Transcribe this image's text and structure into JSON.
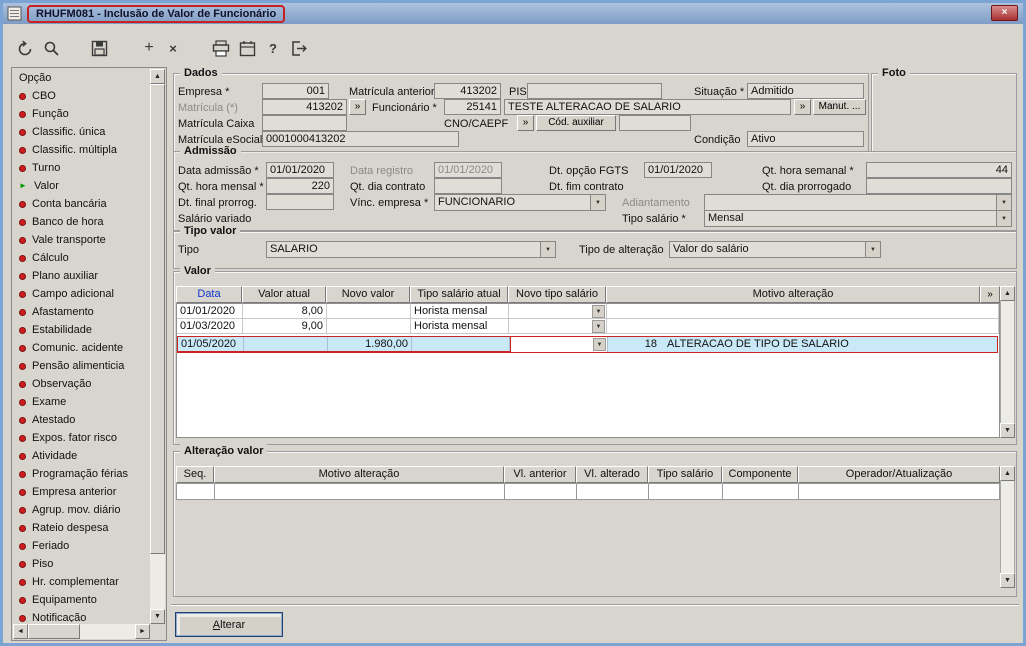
{
  "window": {
    "title": "RHUFM081 - Inclusão de Valor de Funcionário"
  },
  "icons": {
    "add": "+",
    "delete": "×",
    "help": "?",
    "close": "×",
    "lookup": "»",
    "dropdown": "▼",
    "grid_more": "»",
    "selected_arrow": "►",
    "scroll_up": "▲",
    "scroll_down": "▼",
    "scroll_left": "◄",
    "scroll_right": "►",
    "toolbar": [
      "undo",
      "search",
      "save",
      "add",
      "delete",
      "print",
      "calendar",
      "help",
      "exit"
    ]
  },
  "colors": {
    "annotation_red": "#cc2222",
    "selected_row_blue": "#c9e9f8",
    "titlebar_blue": "#7e9cc4",
    "bullet_red": "#cf1d1d",
    "selected_item_green": "#009a00",
    "header_link_blue": "#1133cc"
  },
  "sidebar": {
    "header": "Opção",
    "items": [
      {
        "label": "CBO"
      },
      {
        "label": "Função"
      },
      {
        "label": "Classific. única"
      },
      {
        "label": "Classific. múltipla"
      },
      {
        "label": "Turno"
      },
      {
        "label": "Valor",
        "selected": true
      },
      {
        "label": "Conta bancária"
      },
      {
        "label": "Banco de hora"
      },
      {
        "label": "Vale transporte"
      },
      {
        "label": "Cálculo"
      },
      {
        "label": "Plano auxiliar"
      },
      {
        "label": "Campo adicional"
      },
      {
        "label": "Afastamento"
      },
      {
        "label": "Estabilidade"
      },
      {
        "label": "Comunic. acidente"
      },
      {
        "label": "Pensão alimenticia"
      },
      {
        "label": "Observação"
      },
      {
        "label": "Exame"
      },
      {
        "label": "Atestado"
      },
      {
        "label": "Expos. fator risco"
      },
      {
        "label": "Atividade"
      },
      {
        "label": "Programação férias"
      },
      {
        "label": "Empresa anterior"
      },
      {
        "label": "Agrup. mov. diário"
      },
      {
        "label": "Rateio despesa"
      },
      {
        "label": "Feriado"
      },
      {
        "label": "Piso"
      },
      {
        "label": "Hr. complementar"
      },
      {
        "label": "Equipamento"
      },
      {
        "label": "Notificação"
      }
    ]
  },
  "dados": {
    "title": "Dados",
    "empresa_label": "Empresa *",
    "empresa_value": "001",
    "matricula_anterior_label": "Matrícula anterior",
    "matricula_anterior_value": "413202",
    "pis_label": "PIS",
    "pis_value": "",
    "situacao_label": "Situação *",
    "situacao_value": "Admitido",
    "matricula_label": "Matrícula (*)",
    "matricula_value": "413202",
    "funcionario_label": "Funcionário *",
    "funcionario_value": "25141",
    "funcionario_nome": "TESTE ALTERACAO DE SALARIO",
    "manut_button": "Manut. ...",
    "matricula_caixa_label": "Matrícula Caixa",
    "matricula_caixa_value": "",
    "cno_caepf_label": "CNO/CAEPF",
    "cno_caepf_value": "",
    "cod_auxiliar_button": "Cód. auxiliar",
    "matricula_esocial_label": "Matrícula eSocial",
    "matricula_esocial_value": "0001000413202",
    "condicao_label": "Condição",
    "condicao_value": "Ativo",
    "foto_title": "Foto"
  },
  "admissao": {
    "title": "Admissão",
    "data_admissao_label": "Data admissão *",
    "data_admissao_value": "01/01/2020",
    "data_registro_label": "Data registro",
    "data_registro_value": "01/01/2020",
    "dt_opcao_fgts_label": "Dt. opção FGTS",
    "dt_opcao_fgts_value": "01/01/2020",
    "qt_hora_semanal_label": "Qt. hora semanal *",
    "qt_hora_semanal_value": "44",
    "qt_hora_mensal_label": "Qt. hora mensal *",
    "qt_hora_mensal_value": "220",
    "qt_dia_contrato_label": "Qt. dia contrato",
    "qt_dia_contrato_value": "",
    "dt_fim_contrato_label": "Dt. fim contrato",
    "qt_dia_prorrogado_label": "Qt. dia prorrogado",
    "qt_dia_prorrogado_value": "",
    "dt_final_prorrog_label": "Dt. final prorrog.",
    "dt_final_prorrog_value": "",
    "vinc_empresa_label": "Vínc. empresa *",
    "vinc_empresa_value": "FUNCIONARIO",
    "adiantamento_label": "Adiantamento",
    "adiantamento_value": "",
    "salario_variado_label": "Salário variado",
    "tipo_salario_label": "Tipo salário *",
    "tipo_salario_value": "Mensal"
  },
  "tipo_valor": {
    "title": "Tipo valor",
    "tipo_label": "Tipo",
    "tipo_value": "SALARIO",
    "tipo_alteracao_label": "Tipo de alteração",
    "tipo_alteracao_value": "Valor do salário"
  },
  "valor": {
    "title": "Valor",
    "headers": [
      "Data",
      "Valor atual",
      "Novo valor",
      "Tipo salário atual",
      "Novo tipo salário",
      "Motivo alteração"
    ],
    "rows": [
      {
        "data": "01/01/2020",
        "valor_atual": "8,00",
        "novo_valor": "",
        "tipo_salario_atual": "Horista mensal",
        "novo_tipo_salario": "",
        "motivo_codigo": "",
        "motivo_descricao": ""
      },
      {
        "data": "01/03/2020",
        "valor_atual": "9,00",
        "novo_valor": "",
        "tipo_salario_atual": "Horista mensal",
        "novo_tipo_salario": "",
        "motivo_codigo": "",
        "motivo_descricao": ""
      },
      {
        "data": "01/05/2020",
        "valor_atual": "",
        "novo_valor": "1.980,00",
        "tipo_salario_atual": "",
        "novo_tipo_salario": "",
        "motivo_codigo": "18",
        "motivo_descricao": "ALTERACAO DE TIPO DE SALARIO",
        "selected": true
      }
    ]
  },
  "alteracao_valor": {
    "title": "Alteração valor",
    "headers": [
      "Seq.",
      "Motivo alteração",
      "Vl. anterior",
      "Vl. alterado",
      "Tipo salário",
      "Componente",
      "Operador/Atualização"
    ]
  },
  "footer": {
    "alterar_accel": "A",
    "alterar_rest": "lterar"
  }
}
